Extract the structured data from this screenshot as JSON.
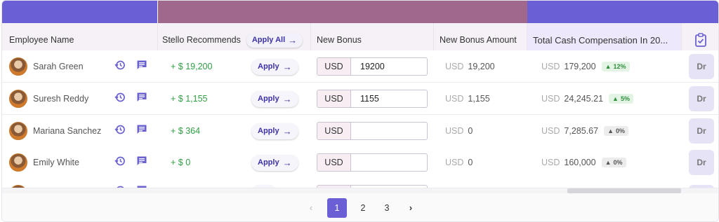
{
  "header": {
    "employee_name": "Employee Name",
    "stello_recommends": "Stello Recommends",
    "apply_all": "Apply All",
    "new_bonus": "New Bonus",
    "new_bonus_amount": "New Bonus Amount",
    "total_cash_comp": "Total Cash Compensation In 20..."
  },
  "rows": [
    {
      "name": "Sarah Green",
      "recommend": "+ $ 19,200",
      "apply": "Apply",
      "currency": "USD",
      "bonus": "19200",
      "bonus_amount": "19,200",
      "total": "179,200",
      "change": "12%",
      "draft": "Dr"
    },
    {
      "name": "Suresh Reddy",
      "recommend": "+ $ 1,155",
      "apply": "Apply",
      "currency": "USD",
      "bonus": "1155",
      "bonus_amount": "1,155",
      "total": "24,245.21",
      "change": "5%",
      "draft": "Dr"
    },
    {
      "name": "Mariana Sanchez",
      "recommend": "+ $ 364",
      "apply": "Apply",
      "currency": "USD",
      "bonus": "",
      "bonus_amount": "0",
      "total": "7,285.67",
      "change": "0%",
      "draft": "Dr"
    },
    {
      "name": "Emily White",
      "recommend": "+ $ 0",
      "apply": "Apply",
      "currency": "USD",
      "bonus": "",
      "bonus_amount": "0",
      "total": "160,000",
      "change": "0%",
      "draft": "Dr"
    }
  ],
  "row_currency_label": "USD",
  "pagination": {
    "pages": [
      "1",
      "2",
      "3"
    ],
    "current": "1"
  },
  "colors": {
    "accent": "#6b5fd6",
    "band_mid": "#a0688c",
    "positive": "#2f9e44"
  }
}
